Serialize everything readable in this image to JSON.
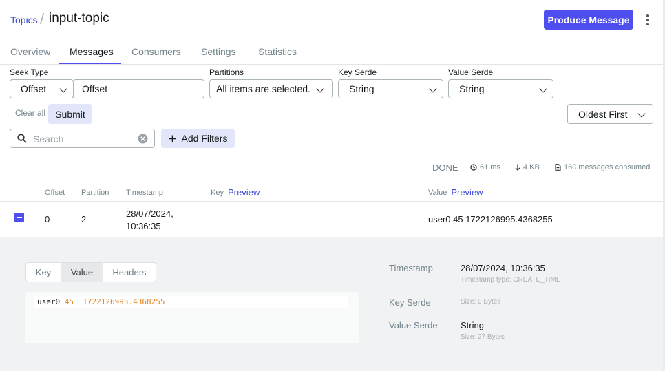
{
  "breadcrumb": {
    "topics_label": "Topics",
    "separator": "/",
    "topic_name": "input-topic"
  },
  "header": {
    "produce_button": "Produce Message"
  },
  "tabs": [
    {
      "label": "Overview"
    },
    {
      "label": "Messages",
      "active": true
    },
    {
      "label": "Consumers"
    },
    {
      "label": "Settings"
    },
    {
      "label": "Statistics"
    }
  ],
  "filters": {
    "seek_type": {
      "label": "Seek Type",
      "selected": "Offset",
      "value_placeholder": "Offset"
    },
    "partitions": {
      "label": "Partitions",
      "selected": "All items are selected."
    },
    "key_serde": {
      "label": "Key Serde",
      "selected": "String"
    },
    "value_serde": {
      "label": "Value Serde",
      "selected": "String"
    },
    "clear_all": "Clear all",
    "submit": "Submit",
    "sort": "Oldest First",
    "search_placeholder": "Search",
    "add_filters": "Add Filters"
  },
  "stats": {
    "status": "DONE",
    "elapsed": "61 ms",
    "size": "4 KB",
    "consumed": "160 messages consumed"
  },
  "table": {
    "headers": {
      "offset": "Offset",
      "partition": "Partition",
      "timestamp": "Timestamp",
      "key": "Key",
      "value": "Value",
      "preview": "Preview"
    },
    "rows": [
      {
        "offset": "0",
        "partition": "2",
        "timestamp_line1": "28/07/2024,",
        "timestamp_line2": "10:36:35",
        "key": "",
        "value": "user0 45 1722126995.4368255"
      }
    ]
  },
  "detail": {
    "tabs": [
      {
        "label": "Key"
      },
      {
        "label": "Value",
        "active": true
      },
      {
        "label": "Headers"
      }
    ],
    "content": {
      "text": "user0",
      "num1": "45",
      "num2": "1722126995.4368255"
    },
    "meta": {
      "timestamp_label": "Timestamp",
      "timestamp_value": "28/07/2024, 10:36:35",
      "timestamp_type": "Timestamp type: CREATE_TIME",
      "key_serde_label": "Key Serde",
      "key_serde_size": "Size: 0 Bytes",
      "value_serde_label": "Value Serde",
      "value_serde_value": "String",
      "value_serde_size": "Size: 27 Bytes"
    }
  },
  "colors": {
    "accent": "#4f4ff0",
    "link": "#3e4ad9",
    "number": "#e48520"
  }
}
